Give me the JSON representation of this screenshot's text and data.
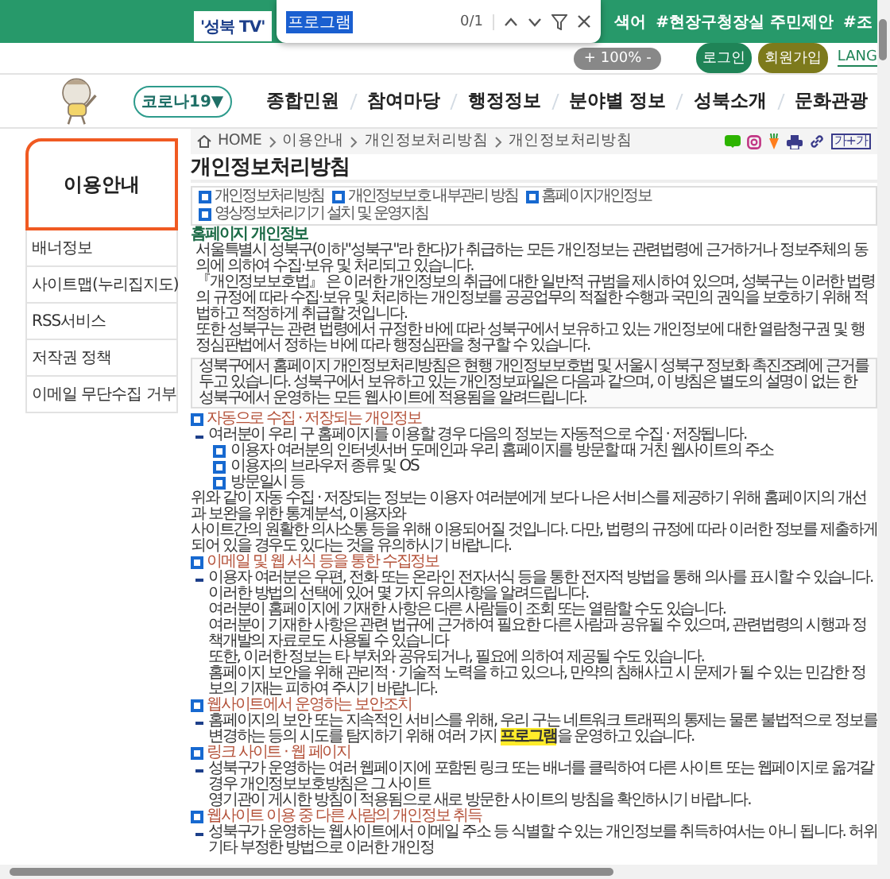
{
  "find_bar": {
    "query": "프로그램",
    "count": "0/1"
  },
  "top_bar": {
    "search_chip": "'성북 TV'",
    "tags": [
      "색어",
      "#현장구청장실 주민제안",
      "#조"
    ]
  },
  "util_bar": {
    "zoom_in": "+",
    "zoom_level": "100%",
    "zoom_out": "-",
    "buttons": [
      {
        "label": "로그인",
        "color": "#1f8457"
      },
      {
        "label": "회원가입",
        "color": "#7d7a1c"
      }
    ],
    "language": "LANG"
  },
  "nav": {
    "covid_menu": "코로나19▼",
    "items": [
      "종합민원",
      "참여마당",
      "행정정보",
      "분야별 정보",
      "성북소개",
      "문화관광"
    ]
  },
  "breadcrumb": {
    "home": "HOME",
    "items": [
      "이용안내",
      "개인정보처리방침",
      "개인정보처리방침"
    ],
    "text_size_button": "가+가"
  },
  "sidebar": {
    "title": "이용안내",
    "items": [
      "배너정보",
      "사이트맵(누리집지도)",
      "RSS서비스",
      "저작권 정책",
      "이메일 무단수집 거부"
    ]
  },
  "page_title": "개인정보처리방침",
  "tabs": [
    "개인정보처리방침",
    "개인정보보호 내부관리 방침",
    "홈페이지개인정보",
    "영상정보처리기기 설치 및 운영지침"
  ],
  "intro": {
    "heading": "홈페이지 개인정보",
    "paragraphs": [
      "서울특별시 성북구(이하\"성북구\"라 한다)가 취급하는 모든 개인정보는 관련법령에 근거하거나 정보주체의 동의에 의하여 수집·보유 및 처리되고 있습니다.",
      "『개인정보보호법』 은 이러한 개인정보의 취급에 대한 일반적 규범을 제시하여 있으며, 성북구는 이러한 법령의 규정에 따라 수집·보유 및 처리하는 개인정보를 공공업무의 적절한 수행과 국민의 권익을 보호하기 위해 적법하고 적정하게 취급할 것입니다.",
      "또한 성북구는 관련 법령에서 규정한 바에 따라 성북구에서 보유하고 있는 개인정보에 대한 열람청구권 및 행정심판법에서 정하는 바에 따라 행정심판을 청구할 수 있습니다."
    ]
  },
  "notice": "성북구에서 홈페이지 개인정보처리방침은 현행 개인정보보호법 및 서울시 성북구 정보화 촉진조례에 근거를 두고 있습니다. 성북구에서 보유하고 있는 개인정보파일은 다음과 같으며, 이 방침은 별도의 설명이 없는 한 성북구에서 운영하는 모든 웹사이트에 적용됨을 알려드립니다.",
  "sections": [
    {
      "heading": "자동으로 수집 · 저장되는 개인정보",
      "items": [
        {
          "kind": "dash",
          "lines": [
            "여러분이 우리 구 홈페이지를 이용할 경우 다음의 정보는 자동적으로 수집 · 저장됩니다."
          ]
        },
        {
          "kind": "square",
          "lines": [
            "이용자 여러분의 인터넷서버 도메인과 우리 홈페이지를 방문할 때 거친 웹사이트의 주소"
          ]
        },
        {
          "kind": "square",
          "lines": [
            "이용자의 브라우저 종류 및 OS"
          ]
        },
        {
          "kind": "square",
          "lines": [
            "방문일시 등"
          ]
        },
        {
          "kind": "plain",
          "lines": [
            "위와 같이 자동 수집 · 저장되는 정보는 이용자 여러분에게 보다 나은 서비스를 제공하기 위해 홈페이지의 개선과 보완을 위한 통계분석, 이용자와",
            "사이트간의 원활한 의사소통 등을 위해 이용되어질 것입니다. 다만, 법령의 규정에 따라 이러한 정보를 제출하게 되어 있을 경우도 있다는 것을 유의하시기 바랍니다."
          ]
        }
      ]
    },
    {
      "heading": "이메일 및 웹 서식 등을 통한 수집정보",
      "items": [
        {
          "kind": "dash",
          "lines": [
            "이용자 여러분은 우편, 전화 또는 온라인 전자서식 등을 통한 전자적 방법을 통해 의사를 표시할 수 있습니다. 이러한 방법의 선택에 있어 몇 가지 유의사항을 알려드립니다.",
            "여러분이 홈페이지에 기재한 사항은 다른 사람들이 조회 또는 열람할 수도 있습니다.",
            "여러분이 기재한 사항은 관련 법규에 근거하여 필요한 다른 사람과 공유될 수 있으며, 관련법령의 시행과 정책개발의 자료로도 사용될 수 있습니다",
            "또한, 이러한 정보는 타 부처와 공유되거나, 필요에 의하여 제공될 수도 있습니다.",
            "홈페이지 보안을 위해 관리적 · 기술적 노력을 하고 있으나, 만약의 침해사고 시 문제가 될 수 있는 민감한 정보의 기재는 피하여 주시기 바랍니다."
          ]
        }
      ]
    },
    {
      "heading": "웹사이트에서 운영하는 보안조치",
      "items": [
        {
          "kind": "dash",
          "lines": [
            "홈페이지의 보안 또는 지속적인 서비스를 위해, 우리 구는 네트워크 트래픽의 통제는 물론 불법적으로 정보를 변경하는 등의 시도를 탐지하기 위해 여러 가지 **프로그램**을 운영하고 있습니다."
          ]
        }
      ]
    },
    {
      "heading": "링크 사이트 · 웹 페이지",
      "items": [
        {
          "kind": "dash",
          "lines": [
            "성북구가 운영하는 여러 웹페이지에 포함된 링크 또는 배너를 클릭하여 다른 사이트 또는 웹페이지로 옮겨갈 경우 개인정보보호방침은 그 사이트",
            "영기관이 게시한 방침이 적용됨으로 새로 방문한 사이트의 방침을 확인하시기 바랍니다."
          ]
        }
      ]
    },
    {
      "heading": "웹사이트 이용 중 다른 사람의 개인정보 취득",
      "items": [
        {
          "kind": "dash",
          "lines": [
            "성북구가 운영하는 웹사이트에서 이메일 주소 등 식별할 수 있는 개인정보를 취득하여서는 아니 됩니다. 허위 기타 부정한 방법으로 이러한 개인정"
          ]
        }
      ]
    }
  ]
}
